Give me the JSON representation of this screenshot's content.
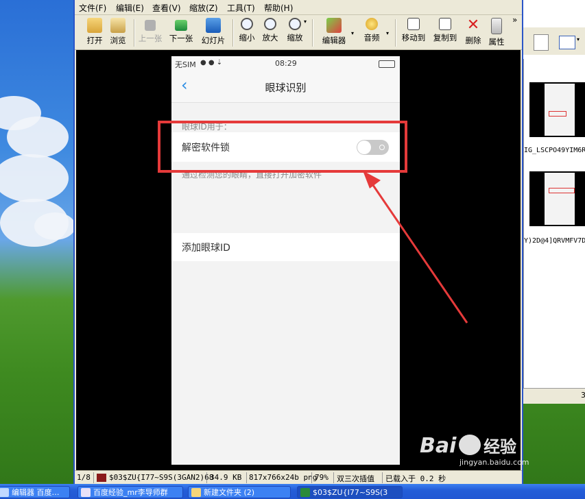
{
  "menu": [
    "文件(F)",
    "编辑(E)",
    "查看(V)",
    "缩放(Z)",
    "工具(T)",
    "帮助(H)"
  ],
  "toolbar": {
    "open": "打开",
    "browse": "浏览",
    "prev": "上一张",
    "next": "下一张",
    "slideshow": "幻灯片",
    "zoom_out": "缩小",
    "zoom_in": "放大",
    "zoom": "缩放",
    "editor": "编辑器",
    "audio": "音频",
    "move_to": "移动到",
    "copy_to": "复制到",
    "delete": "删除",
    "properties": "属性",
    "overflow": "»"
  },
  "phone": {
    "carrier": "无SIM",
    "time": "08:29",
    "title": "眼球识别",
    "section_header": "眼球ID用于：",
    "setting_label": "解密软件锁",
    "setting_desc": "通过检测您的眼睛，直接打开加密软件",
    "toggle_on": false,
    "add_label": "添加眼球ID"
  },
  "statusbar": {
    "index": "1/8",
    "filename": "$03$ZU{I77~S9S(3GAN2)68",
    "filesize": "34.9 KB",
    "dimensions": "817x766x24b png",
    "zoom": "79%",
    "filter": "双三次插值",
    "load_time": "已载入于 0.2 秒"
  },
  "right_panel": {
    "thumb1_name": "IG_LSCPO49YIM6R",
    "thumb2_name": "Y)2D@4]QRVMFV7D",
    "corner_label": "3"
  },
  "taskbar": {
    "items": [
      "编辑器 百度…",
      "百度经验_mr李导师群",
      "新建文件夹 (2)",
      "$03$ZU{I77~S9S(3"
    ]
  },
  "watermark": {
    "brand": "Bai",
    "brand_cn": "经验",
    "url": "jingyan.baidu.com"
  },
  "colors": {
    "highlight": "#e53a3a",
    "ios_blue": "#2b8de4",
    "toggle_off": "#c9c9c9"
  }
}
